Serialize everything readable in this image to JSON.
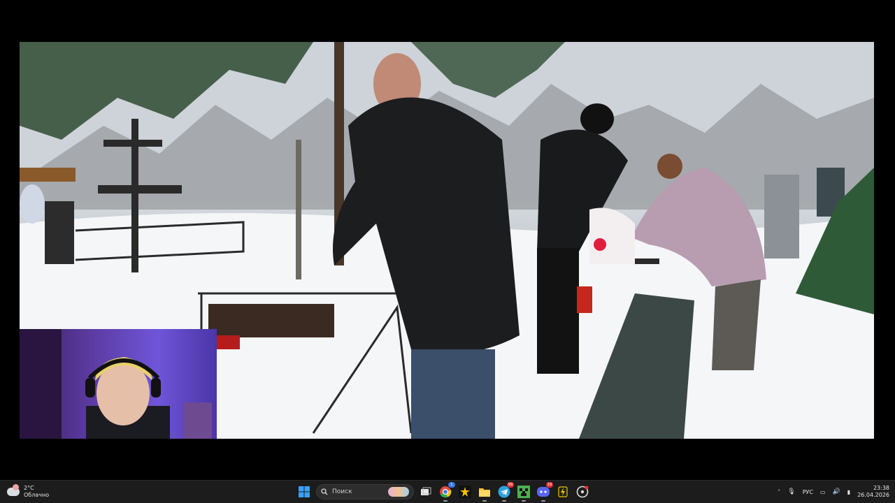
{
  "taskbar": {
    "weather": {
      "temp": "2°C",
      "condition": "Облачно",
      "icon": "cloud-icon"
    },
    "search_label": "Поиск",
    "apps": [
      {
        "name": "start-button",
        "icon": "windows-logo-icon"
      },
      {
        "name": "task-view-button",
        "icon": "task-view-icon"
      },
      {
        "name": "chrome-button",
        "icon": "chrome-icon",
        "badge": "1"
      },
      {
        "name": "photo-app-button",
        "icon": "burst-icon"
      },
      {
        "name": "file-explorer-button",
        "icon": "folder-icon"
      },
      {
        "name": "telegram-button",
        "icon": "telegram-icon",
        "badge": "99"
      },
      {
        "name": "minecraft-button",
        "icon": "creeper-icon"
      },
      {
        "name": "discord-button",
        "icon": "discord-icon",
        "badge": "19"
      },
      {
        "name": "utility-button",
        "icon": "bolt-icon"
      },
      {
        "name": "obs-button",
        "icon": "record-icon"
      }
    ],
    "tray": {
      "chevron": "˄",
      "mic": "🎙",
      "lang": "РУС",
      "network_icon": "▭",
      "volume_icon": "🔊",
      "battery_icon": "▮"
    },
    "clock": {
      "time": "23:38",
      "date": "26.04.2026"
    }
  },
  "colors": {
    "taskbar_bg": "#1c1c1c",
    "accent": "#0078d4"
  }
}
